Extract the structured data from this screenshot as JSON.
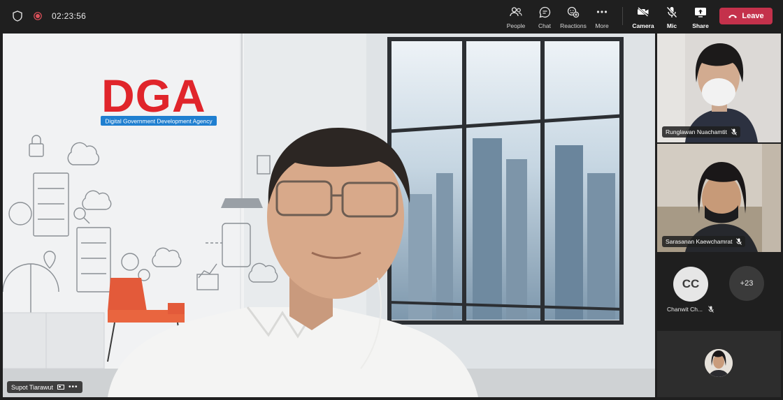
{
  "meeting": {
    "timer": "02:23:56"
  },
  "toolbar": {
    "people_label": "People",
    "chat_label": "Chat",
    "reactions_label": "Reactions",
    "more_label": "More",
    "camera_label": "Camera",
    "mic_label": "Mic",
    "share_label": "Share",
    "leave_label": "Leave"
  },
  "main_video": {
    "speaker_name": "Supot Tiarawut",
    "logo_text": "DGA",
    "logo_subtitle": "Digital Government Development Agency"
  },
  "participants": [
    {
      "name": "Runglawan Nuachamtit",
      "muted": true
    },
    {
      "name": "Sarasanan Kaewchamrat",
      "muted": true
    },
    {
      "name": "Chanwit Ch...",
      "initials": "CC",
      "muted": true
    }
  ],
  "overflow": {
    "count_label": "+23"
  },
  "colors": {
    "leave": "#c4314b",
    "recording": "#e0515b",
    "dga_red": "#e0252b",
    "dga_blue": "#1f7fd0"
  }
}
